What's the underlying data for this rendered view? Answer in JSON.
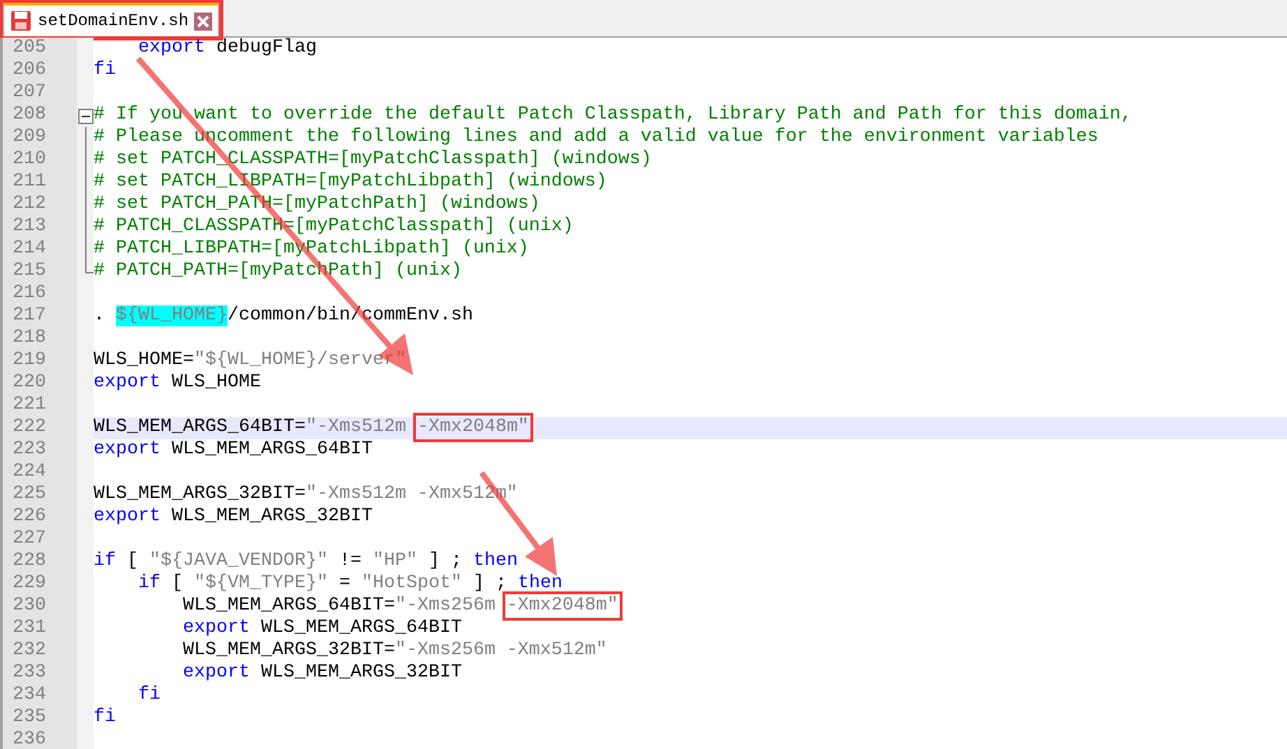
{
  "tabs": [
    {
      "label": "setDomainEnv.sh",
      "selected": true,
      "boxed": true
    }
  ],
  "lines": [
    {
      "number": "205",
      "current": false,
      "fold_start": false,
      "in_fold": false,
      "tokens": [
        {
          "t": "    export",
          "kind": "keyword"
        },
        {
          "t": " debugFlag",
          "kind": "plain"
        }
      ]
    },
    {
      "number": "206",
      "current": false,
      "fold_start": false,
      "in_fold": false,
      "tokens": [
        {
          "t": "fi",
          "kind": "keyword"
        }
      ]
    },
    {
      "number": "207",
      "current": false,
      "fold_start": false,
      "in_fold": false
    },
    {
      "number": "208",
      "current": false,
      "fold_start": true,
      "in_fold": false,
      "tokens": [
        {
          "t": "# If you want to override the default Patch Classpath, Library Path and Path for this domain,",
          "kind": "comment"
        }
      ]
    },
    {
      "number": "209",
      "current": false,
      "fold_start": false,
      "in_fold": true,
      "tokens": [
        {
          "t": "# Please uncomment the following lines and add a valid value for the environment variables",
          "kind": "comment"
        }
      ]
    },
    {
      "number": "210",
      "current": false,
      "fold_start": false,
      "in_fold": true,
      "tokens": [
        {
          "t": "# set PATCH_CLASSPATH=[myPatchClasspath] (windows)",
          "kind": "comment"
        }
      ]
    },
    {
      "number": "211",
      "current": false,
      "fold_start": false,
      "in_fold": true,
      "tokens": [
        {
          "t": "# set PATCH_LIBPATH=[myPatchLibpath] (windows)",
          "kind": "comment"
        }
      ]
    },
    {
      "number": "212",
      "current": false,
      "fold_start": false,
      "in_fold": true,
      "tokens": [
        {
          "t": "# set PATCH_PATH=[myPatchPath] (windows)",
          "kind": "comment"
        }
      ]
    },
    {
      "number": "213",
      "current": false,
      "fold_start": false,
      "in_fold": true,
      "tokens": [
        {
          "t": "# PATCH_CLASSPATH=[myPatchClasspath] (unix)",
          "kind": "comment"
        }
      ]
    },
    {
      "number": "214",
      "current": false,
      "fold_start": false,
      "in_fold": true,
      "tokens": [
        {
          "t": "# PATCH_LIBPATH=[myPatchLibpath] (unix)",
          "kind": "comment"
        }
      ]
    },
    {
      "number": "215",
      "current": false,
      "fold_start": false,
      "in_fold": true,
      "tokens": [
        {
          "t": "# PATCH_PATH=[myPatchPath] (unix)",
          "kind": "comment"
        }
      ]
    },
    {
      "number": "216",
      "current": false,
      "fold_start": false,
      "in_fold": false
    },
    {
      "number": "217",
      "current": false,
      "fold_start": false,
      "in_fold": false,
      "tokens": [
        {
          "t": ". ",
          "kind": "plain"
        },
        {
          "t": "${WL_HOME}",
          "kind": "variable"
        },
        {
          "t": "/common/bin/commEnv.sh",
          "kind": "plain"
        }
      ]
    },
    {
      "number": "218",
      "current": false,
      "fold_start": false,
      "in_fold": false
    },
    {
      "number": "219",
      "current": false,
      "fold_start": false,
      "in_fold": false,
      "tokens": [
        {
          "t": "WLS_HOME=",
          "kind": "plain"
        },
        {
          "t": "\"${WL_HOME}/server\"",
          "kind": "string"
        }
      ]
    },
    {
      "number": "220",
      "current": false,
      "fold_start": false,
      "in_fold": false,
      "tokens": [
        {
          "t": "export",
          "kind": "keyword"
        },
        {
          "t": " WLS_HOME",
          "kind": "plain"
        }
      ]
    },
    {
      "number": "221",
      "current": false,
      "fold_start": false,
      "in_fold": false
    },
    {
      "number": "222",
      "current": true,
      "fold_start": false,
      "in_fold": false,
      "tokens": [
        {
          "t": "WLS_MEM_ARGS_64BIT=",
          "kind": "plain"
        },
        {
          "t": "\"-Xms512m ",
          "kind": "string"
        },
        {
          "t": "-Xmx2048m\"",
          "kind": "string",
          "boxed": true
        }
      ]
    },
    {
      "number": "223",
      "current": false,
      "fold_start": false,
      "in_fold": false,
      "tokens": [
        {
          "t": "export",
          "kind": "keyword"
        },
        {
          "t": " WLS_MEM_ARGS_64BIT",
          "kind": "plain"
        }
      ]
    },
    {
      "number": "224",
      "current": false,
      "fold_start": false,
      "in_fold": false
    },
    {
      "number": "225",
      "current": false,
      "fold_start": false,
      "in_fold": false,
      "tokens": [
        {
          "t": "WLS_MEM_ARGS_32BIT=",
          "kind": "plain"
        },
        {
          "t": "\"-Xms512m -Xmx512m\"",
          "kind": "string"
        }
      ]
    },
    {
      "number": "226",
      "current": false,
      "fold_start": false,
      "in_fold": false,
      "tokens": [
        {
          "t": "export",
          "kind": "keyword"
        },
        {
          "t": " WLS_MEM_ARGS_32BIT",
          "kind": "plain"
        }
      ]
    },
    {
      "number": "227",
      "current": false,
      "fold_start": false,
      "in_fold": false
    },
    {
      "number": "228",
      "current": false,
      "fold_start": false,
      "in_fold": false,
      "tokens": [
        {
          "t": "if",
          "kind": "keyword"
        },
        {
          "t": " [ ",
          "kind": "plain"
        },
        {
          "t": "\"${JAVA_VENDOR}\"",
          "kind": "string"
        },
        {
          "t": " != ",
          "kind": "plain"
        },
        {
          "t": "\"HP\"",
          "kind": "string"
        },
        {
          "t": " ] ; ",
          "kind": "plain"
        },
        {
          "t": "then",
          "kind": "keyword"
        }
      ]
    },
    {
      "number": "229",
      "current": false,
      "fold_start": false,
      "in_fold": false,
      "tokens": [
        {
          "t": "    if",
          "kind": "keyword"
        },
        {
          "t": " [ ",
          "kind": "plain"
        },
        {
          "t": "\"${VM_TYPE}\"",
          "kind": "string"
        },
        {
          "t": " = ",
          "kind": "plain"
        },
        {
          "t": "\"HotSpot\"",
          "kind": "string"
        },
        {
          "t": " ] ; ",
          "kind": "plain"
        },
        {
          "t": "then",
          "kind": "keyword"
        }
      ]
    },
    {
      "number": "230",
      "current": false,
      "fold_start": false,
      "in_fold": false,
      "tokens": [
        {
          "t": "        WLS_MEM_ARGS_64BIT=",
          "kind": "plain"
        },
        {
          "t": "\"-Xms256m ",
          "kind": "string"
        },
        {
          "t": "-Xmx2048m\"",
          "kind": "string",
          "boxed": true
        }
      ]
    },
    {
      "number": "231",
      "current": false,
      "fold_start": false,
      "in_fold": false,
      "tokens": [
        {
          "t": "        export",
          "kind": "keyword"
        },
        {
          "t": " WLS_MEM_ARGS_64BIT",
          "kind": "plain"
        }
      ]
    },
    {
      "number": "232",
      "current": false,
      "fold_start": false,
      "in_fold": false,
      "tokens": [
        {
          "t": "        WLS_MEM_ARGS_32BIT=",
          "kind": "plain"
        },
        {
          "t": "\"-Xms256m -Xmx512m\"",
          "kind": "string"
        }
      ]
    },
    {
      "number": "233",
      "current": false,
      "fold_start": false,
      "in_fold": false,
      "tokens": [
        {
          "t": "        export",
          "kind": "keyword"
        },
        {
          "t": " WLS_MEM_ARGS_32BIT",
          "kind": "plain"
        }
      ]
    },
    {
      "number": "234",
      "current": false,
      "fold_start": false,
      "in_fold": false,
      "tokens": [
        {
          "t": "    fi",
          "kind": "keyword"
        }
      ]
    },
    {
      "number": "235",
      "current": false,
      "fold_start": false,
      "in_fold": false,
      "tokens": [
        {
          "t": "fi",
          "kind": "keyword"
        }
      ]
    },
    {
      "number": "236",
      "current": false,
      "fold_start": false,
      "in_fold": false
    }
  ]
}
